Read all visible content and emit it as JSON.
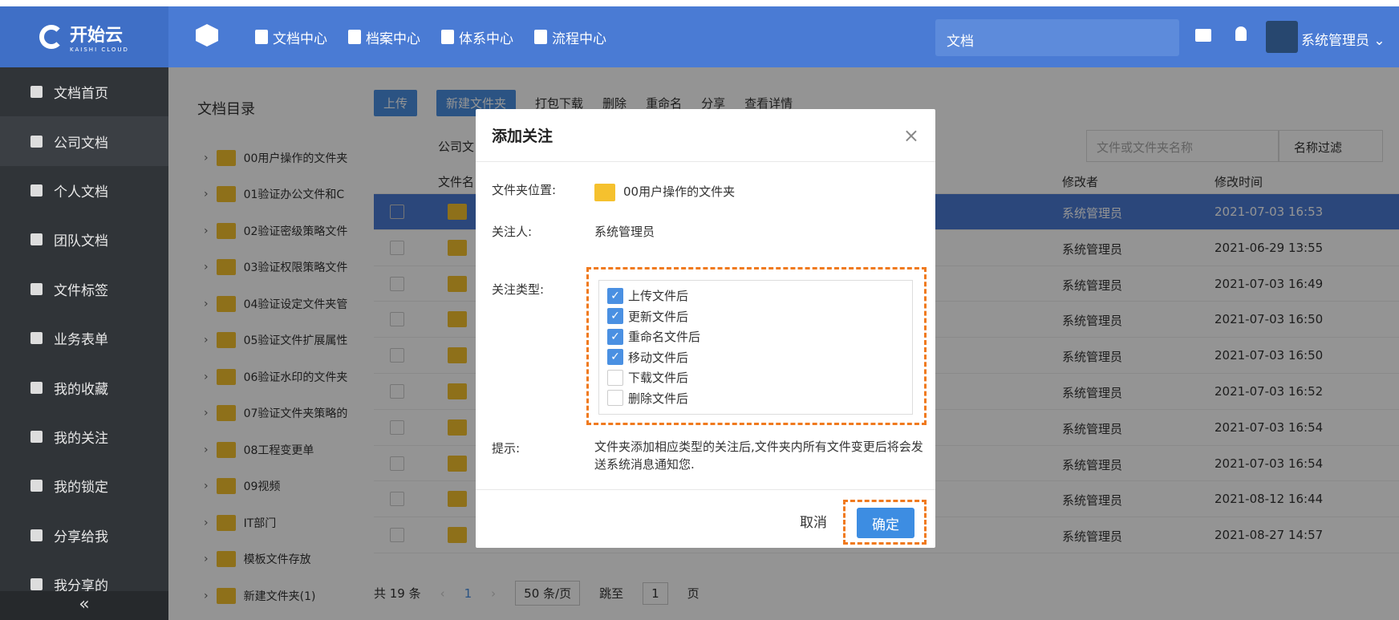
{
  "header": {
    "logo_text": "开始云",
    "logo_sub": "KAISHI CLOUD",
    "nav": [
      "文档中心",
      "档案中心",
      "体系中心",
      "流程中心"
    ],
    "search_value": "文档",
    "user_name": "系统管理员"
  },
  "sidebar": {
    "items": [
      "文档首页",
      "公司文档",
      "个人文档",
      "团队文档",
      "文件标签",
      "业务表单",
      "我的收藏",
      "我的关注",
      "我的锁定",
      "分享给我",
      "我分享的"
    ],
    "collapse": "«"
  },
  "tree": {
    "title": "文档目录",
    "items": [
      "00用户操作的文件夹",
      "01验证办公文件和C",
      "02验证密级策略文件",
      "03验证权限策略文件",
      "04验证设定文件夹管",
      "05验证文件扩展属性",
      "06验证水印的文件夹",
      "07验证文件夹策略的",
      "08工程变更单",
      "09视频",
      "IT部门",
      "模板文件存放",
      "新建文件夹(1)"
    ]
  },
  "toolbar": {
    "upload": "上传",
    "new_folder": "新建文件夹",
    "download": "打包下载",
    "delete": "删除",
    "rename": "重命名",
    "share": "分享",
    "details": "查看详情",
    "filter_placeholder": "文件或文件夹名称",
    "filter_select": "名称过滤"
  },
  "table": {
    "path": "公司文",
    "col_name": "文件名",
    "col_modifier": "修改者",
    "col_time": "修改时间",
    "rows": [
      {
        "by": "系统管理员",
        "time": "2021-07-03 16:53"
      },
      {
        "by": "系统管理员",
        "time": "2021-06-29 13:55"
      },
      {
        "by": "系统管理员",
        "time": "2021-07-03 16:49"
      },
      {
        "by": "系统管理员",
        "time": "2021-07-03 16:50"
      },
      {
        "by": "系统管理员",
        "time": "2021-07-03 16:50"
      },
      {
        "by": "系统管理员",
        "time": "2021-07-03 16:52"
      },
      {
        "by": "系统管理员",
        "time": "2021-07-03 16:54"
      },
      {
        "by": "系统管理员",
        "time": "2021-07-03 16:54"
      },
      {
        "by": "系统管理员",
        "time": "2021-08-12 16:44"
      },
      {
        "by": "系统管理员",
        "time": "2021-08-27 14:57"
      }
    ]
  },
  "pager": {
    "total": "共 19 条",
    "page": "1",
    "size": "50 条/页",
    "jump": "跳至",
    "jump_value": "1",
    "page_unit": "页"
  },
  "modal": {
    "title": "添加关注",
    "location_label": "文件夹位置:",
    "location_value": "00用户操作的文件夹",
    "follower_label": "关注人:",
    "follower_value": "系统管理员",
    "type_label": "关注类型:",
    "types": [
      {
        "label": "上传文件后",
        "checked": true
      },
      {
        "label": "更新文件后",
        "checked": true
      },
      {
        "label": "重命名文件后",
        "checked": true
      },
      {
        "label": "移动文件后",
        "checked": true
      },
      {
        "label": "下载文件后",
        "checked": false
      },
      {
        "label": "删除文件后",
        "checked": false
      }
    ],
    "hint_label": "提示:",
    "hint_text": "文件夹添加相应类型的关注后,文件夹内所有文件变更后将会发送系统消息通知您.",
    "cancel": "取消",
    "ok": "确定"
  }
}
